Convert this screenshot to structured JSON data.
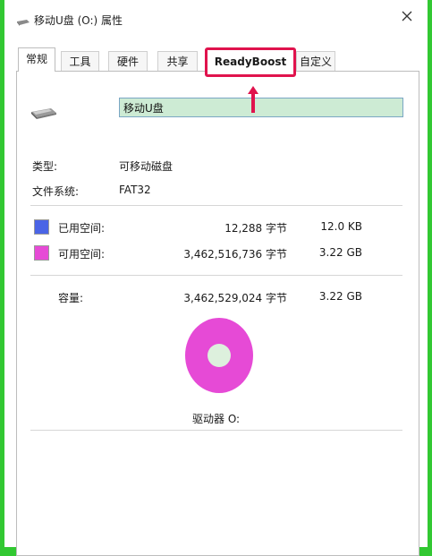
{
  "window": {
    "title": "移动U盘 (O:) 属性",
    "close_glyph": "X"
  },
  "tabs": [
    {
      "label": "常规",
      "active": true
    },
    {
      "label": "工具"
    },
    {
      "label": "硬件"
    },
    {
      "label": "共享"
    },
    {
      "label": "ReadyBoost",
      "highlighted": true
    },
    {
      "label": "自定义"
    }
  ],
  "general": {
    "drive_name": "移动U盘",
    "type_label": "类型:",
    "type_value": "可移动磁盘",
    "fs_label": "文件系统:",
    "fs_value": "FAT32",
    "used": {
      "label": "已用空间:",
      "bytes": "12,288 字节",
      "size": "12.0 KB",
      "color": "#4a64e6"
    },
    "free": {
      "label": "可用空间:",
      "bytes": "3,462,516,736 字节",
      "size": "3.22 GB",
      "color": "#e64ad6"
    },
    "capacity": {
      "label": "容量:",
      "bytes": "3,462,529,024 字节",
      "size": "3.22 GB"
    },
    "drive_caption": "驱动器 O:"
  },
  "annotation": {
    "highlight_color": "#e0134d"
  }
}
